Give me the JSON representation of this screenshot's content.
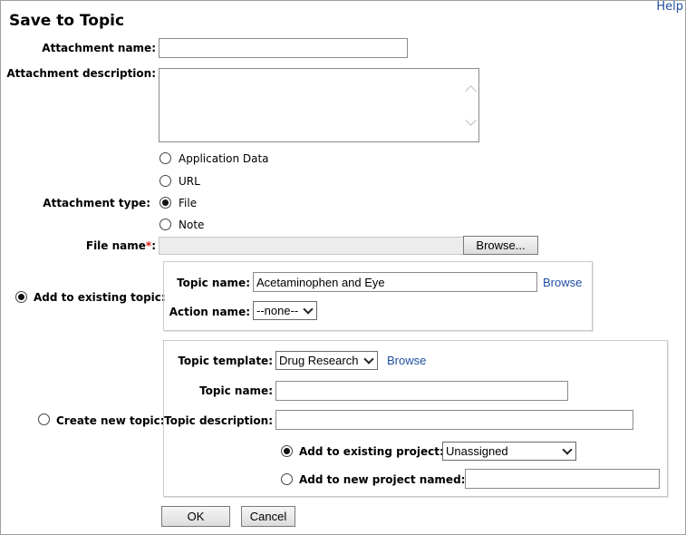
{
  "header": {
    "title": "Save to Topic",
    "help": "Help"
  },
  "attachment": {
    "name_label": "Attachment name:",
    "name_value": "",
    "description_label": "Attachment description:",
    "description_value": "",
    "type_label": "Attachment type:",
    "type_options": [
      "Application Data",
      "URL",
      "File",
      "Note"
    ],
    "type_selected": "File",
    "file_label": "File name",
    "file_required_mark": "*",
    "file_suffix": ":",
    "browse_button": "Browse..."
  },
  "existing_topic": {
    "radio_label": "Add to existing topic:",
    "selected": true,
    "topic_name_label": "Topic name:",
    "topic_name_value": "Acetaminophen and Eye",
    "browse_link": "Browse",
    "action_name_label": "Action name:",
    "action_name_value": "--none--"
  },
  "new_topic": {
    "radio_label": "Create new topic:",
    "selected": false,
    "template_label": "Topic template:",
    "template_value": "Drug Research",
    "browse_link": "Browse",
    "topic_name_label": "Topic name:",
    "topic_name_value": "",
    "description_label": "Topic description:",
    "description_value": "",
    "existing_project_label": "Add to existing project:",
    "existing_project_value": "Unassigned",
    "existing_project_selected": true,
    "new_project_label": "Add to new project named:",
    "new_project_value": ""
  },
  "footer": {
    "ok": "OK",
    "cancel": "Cancel"
  },
  "icons": [
    "chevron-down-icon",
    "radio-icon",
    "scroll-up-icon",
    "scroll-down-icon"
  ]
}
